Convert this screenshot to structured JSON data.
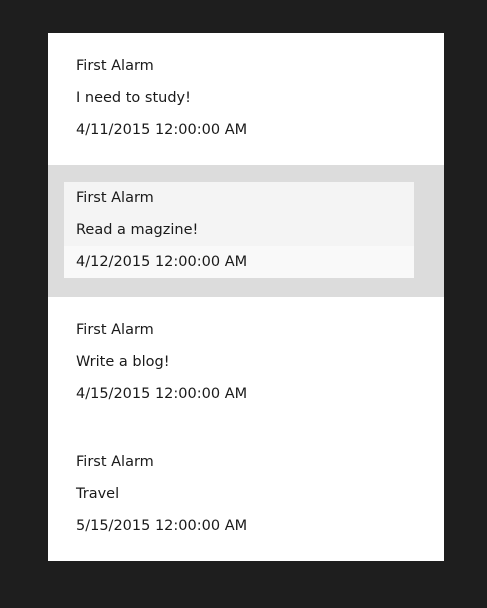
{
  "alarms": [
    {
      "title": "First Alarm",
      "message": "I need to study!",
      "datetime": "4/11/2015 12:00:00 AM",
      "selected": false
    },
    {
      "title": "First Alarm",
      "message": "Read a magzine!",
      "datetime": "4/12/2015 12:00:00 AM",
      "selected": true
    },
    {
      "title": "First Alarm",
      "message": "Write a blog!",
      "datetime": "4/15/2015 12:00:00 AM",
      "selected": false
    },
    {
      "title": "First Alarm",
      "message": "Travel",
      "datetime": "5/15/2015 12:00:00 AM",
      "selected": false
    }
  ],
  "colors": {
    "background": "#1e1e1e",
    "panel": "#ffffff",
    "selected_item": "#dcdcdc",
    "selected_inner": "#f4f4f4",
    "text": "#1a1a1a"
  }
}
